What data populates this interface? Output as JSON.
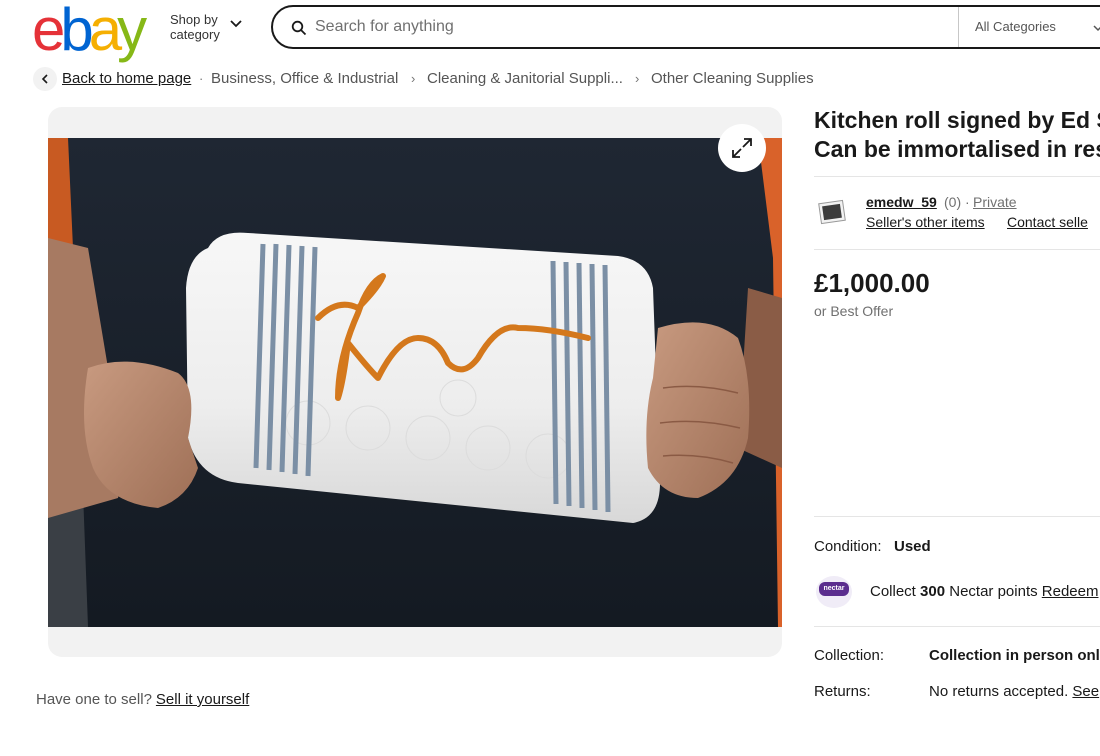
{
  "header": {
    "logo_letters": [
      "e",
      "b",
      "a",
      "y"
    ],
    "logo_colors": [
      "#e53238",
      "#0064d2",
      "#f5af02",
      "#86b817"
    ],
    "shop_by_line1": "Shop by",
    "shop_by_line2": "category",
    "search_placeholder": "Search for anything",
    "category_select": "All Categories"
  },
  "breadcrumb": {
    "back": "Back to home page",
    "items": [
      "Business, Office & Industrial",
      "Cleaning & Janitorial Suppli...",
      "Other Cleaning Supplies"
    ]
  },
  "listing": {
    "title_line1": "Kitchen roll signed by Ed S",
    "title_line2": "Can be immortalised in res",
    "seller": {
      "name": "emedw_59",
      "score": "(0)",
      "separator": "·",
      "type": "Private",
      "other_items": "Seller's other items",
      "contact": "Contact selle"
    },
    "price": "£1,000.00",
    "best_offer": "or Best Offer",
    "condition_label": "Condition:",
    "condition_value": "Used",
    "nectar_logo_text": "nectar",
    "nectar_prefix": "Collect",
    "nectar_points": "300",
    "nectar_suffix": "Nectar points",
    "nectar_redeem": "Redeem",
    "collection_label": "Collection:",
    "collection_value": "Collection in person only",
    "returns_label": "Returns:",
    "returns_value": "No returns accepted.",
    "returns_see": "See"
  },
  "footer": {
    "sell_prompt": "Have one to sell?",
    "sell_link": "Sell it yourself"
  },
  "icons": {
    "search": "search-icon",
    "expand": "expand-icon",
    "back": "chevron-left-icon",
    "chevron": "chevron-down-icon"
  }
}
